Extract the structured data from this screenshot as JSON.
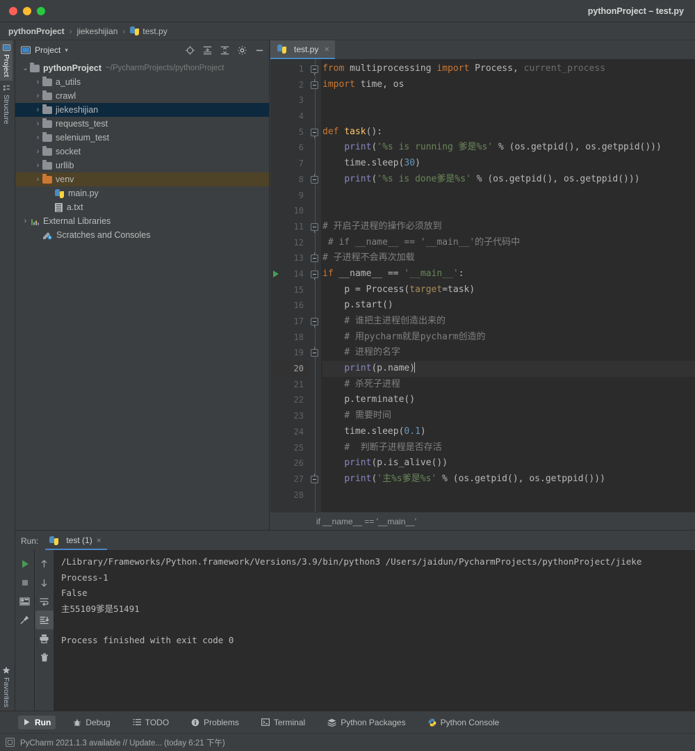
{
  "window": {
    "title": "pythonProject – test.py",
    "traffic_lights": [
      "close",
      "minimize",
      "zoom"
    ]
  },
  "navbar": {
    "crumbs": [
      {
        "label": "pythonProject",
        "icon": ""
      },
      {
        "label": "jiekeshijian",
        "icon": ""
      },
      {
        "label": "test.py",
        "icon": "python-file-icon"
      }
    ],
    "separator": "›"
  },
  "rail": {
    "top": [
      {
        "label": "Project",
        "icon": "project-icon",
        "active": true
      },
      {
        "label": "Structure",
        "icon": "structure-icon",
        "active": false
      }
    ],
    "bottom": [
      {
        "label": "Favorites",
        "icon": "star-icon",
        "active": false
      }
    ]
  },
  "project_panel": {
    "title": "Project",
    "dropdown_caret": "▾",
    "icons": [
      {
        "name": "select-opened-file-icon",
        "glyph": "locate"
      },
      {
        "name": "expand-all-icon",
        "glyph": "expand"
      },
      {
        "name": "collapse-all-icon",
        "glyph": "collapse"
      },
      {
        "name": "settings-gear-icon",
        "glyph": "gear"
      },
      {
        "name": "hide-panel-icon",
        "glyph": "minus"
      }
    ],
    "tree": [
      {
        "label": "pythonProject",
        "path": "~/PycharmProjects/pythonProject",
        "indent": 0,
        "arrow": "⌄",
        "icon": "folder",
        "bold": true,
        "state": "none"
      },
      {
        "label": "a_utils",
        "path": "",
        "indent": 1,
        "arrow": "›",
        "icon": "folder",
        "bold": false,
        "state": "none"
      },
      {
        "label": "crawl",
        "path": "",
        "indent": 1,
        "arrow": "›",
        "icon": "folder",
        "bold": false,
        "state": "none"
      },
      {
        "label": "jiekeshijian",
        "path": "",
        "indent": 1,
        "arrow": "›",
        "icon": "folder",
        "bold": false,
        "state": "selected"
      },
      {
        "label": "requests_test",
        "path": "",
        "indent": 1,
        "arrow": "›",
        "icon": "folder",
        "bold": false,
        "state": "none"
      },
      {
        "label": "selenium_test",
        "path": "",
        "indent": 1,
        "arrow": "›",
        "icon": "folder",
        "bold": false,
        "state": "none"
      },
      {
        "label": "socket",
        "path": "",
        "indent": 1,
        "arrow": "›",
        "icon": "folder",
        "bold": false,
        "state": "none"
      },
      {
        "label": "urllib",
        "path": "",
        "indent": 1,
        "arrow": "›",
        "icon": "folder",
        "bold": false,
        "state": "none"
      },
      {
        "label": "venv",
        "path": "",
        "indent": 1,
        "arrow": "›",
        "icon": "folder-orange",
        "bold": false,
        "state": "highlight"
      },
      {
        "label": "main.py",
        "path": "",
        "indent": 2,
        "arrow": "",
        "icon": "python-file",
        "bold": false,
        "state": "none"
      },
      {
        "label": "a.txt",
        "path": "",
        "indent": 2,
        "arrow": "",
        "icon": "text-file",
        "bold": false,
        "state": "none"
      },
      {
        "label": "External Libraries",
        "path": "",
        "indent": 0,
        "arrow": "›",
        "icon": "library",
        "bold": false,
        "state": "none"
      },
      {
        "label": "Scratches and Consoles",
        "path": "",
        "indent": 1,
        "arrow": "",
        "icon": "scratches",
        "bold": false,
        "state": "none"
      }
    ]
  },
  "editor": {
    "tab": {
      "label": "test.py",
      "icon": "python-file-icon",
      "close": "×"
    },
    "breadcrumb_bottom": "if __name__ == '__main__'",
    "current_line": 20,
    "run_marker_line": 14,
    "lines": [
      {
        "n": 1,
        "fold": "open",
        "text": "from multiprocessing import Process, current_process"
      },
      {
        "n": 2,
        "fold": "end",
        "text": "import time, os"
      },
      {
        "n": 3,
        "fold": "",
        "text": ""
      },
      {
        "n": 4,
        "fold": "",
        "text": ""
      },
      {
        "n": 5,
        "fold": "open",
        "text": "def task():"
      },
      {
        "n": 6,
        "fold": "",
        "text": "    print('%s is running 爹是%s' % (os.getpid(), os.getppid()))"
      },
      {
        "n": 7,
        "fold": "",
        "text": "    time.sleep(30)"
      },
      {
        "n": 8,
        "fold": "end",
        "text": "    print('%s is done爹是%s' % (os.getpid(), os.getppid()))"
      },
      {
        "n": 9,
        "fold": "",
        "text": ""
      },
      {
        "n": 10,
        "fold": "",
        "text": ""
      },
      {
        "n": 11,
        "fold": "open",
        "text": "# 开启子进程的操作必须放到"
      },
      {
        "n": 12,
        "fold": "",
        "text": " # if __name__ == '__main__'的子代码中"
      },
      {
        "n": 13,
        "fold": "end",
        "text": "# 子进程不会再次加载"
      },
      {
        "n": 14,
        "fold": "open",
        "text": "if __name__ == '__main__':"
      },
      {
        "n": 15,
        "fold": "",
        "text": "    p = Process(target=task)"
      },
      {
        "n": 16,
        "fold": "",
        "text": "    p.start()"
      },
      {
        "n": 17,
        "fold": "open",
        "text": "    # 谁把主进程创造出来的"
      },
      {
        "n": 18,
        "fold": "",
        "text": "    # 用pycharm就是pycharm创造的"
      },
      {
        "n": 19,
        "fold": "end",
        "text": "    # 进程的名字"
      },
      {
        "n": 20,
        "fold": "",
        "text": "    print(p.name)"
      },
      {
        "n": 21,
        "fold": "",
        "text": "    # 杀死子进程"
      },
      {
        "n": 22,
        "fold": "",
        "text": "    p.terminate()"
      },
      {
        "n": 23,
        "fold": "",
        "text": "    # 需要时间"
      },
      {
        "n": 24,
        "fold": "",
        "text": "    time.sleep(0.1)"
      },
      {
        "n": 25,
        "fold": "",
        "text": "    #  判断子进程是否存活"
      },
      {
        "n": 26,
        "fold": "",
        "text": "    print(p.is_alive())"
      },
      {
        "n": 27,
        "fold": "end",
        "text": "    print('主%s爹是%s' % (os.getpid(), os.getppid()))"
      },
      {
        "n": 28,
        "fold": "",
        "text": ""
      }
    ]
  },
  "run_panel": {
    "label": "Run:",
    "tab": {
      "label": "test (1)",
      "icon": "python-file-icon",
      "close": "×"
    },
    "tools_left": [
      {
        "name": "rerun-button",
        "glyph": "play"
      },
      {
        "name": "stop-button",
        "glyph": "stop"
      },
      {
        "name": "restore-layout-button",
        "glyph": "layout"
      },
      {
        "name": "pin-tab-button",
        "glyph": "pin"
      }
    ],
    "tools_right": [
      {
        "name": "up-button",
        "glyph": "up"
      },
      {
        "name": "down-button",
        "glyph": "down"
      },
      {
        "name": "soft-wrap-button",
        "glyph": "wrap"
      },
      {
        "name": "scroll-to-end-button",
        "glyph": "scroll-end",
        "active": true
      },
      {
        "name": "print-button",
        "glyph": "print"
      },
      {
        "name": "clear-all-button",
        "glyph": "trash"
      }
    ],
    "output": [
      "/Library/Frameworks/Python.framework/Versions/3.9/bin/python3 /Users/jaidun/PycharmProjects/pythonProject/jieke",
      "Process-1",
      "False",
      "主55109爹是51491",
      "",
      "Process finished with exit code 0"
    ]
  },
  "bottom_toolbar": [
    {
      "label": "Run",
      "icon": "play-icon",
      "active": true
    },
    {
      "label": "Debug",
      "icon": "bug-icon",
      "active": false
    },
    {
      "label": "TODO",
      "icon": "todo-icon",
      "active": false
    },
    {
      "label": "Problems",
      "icon": "info-icon",
      "active": false
    },
    {
      "label": "Terminal",
      "icon": "terminal-icon",
      "active": false
    },
    {
      "label": "Python Packages",
      "icon": "packages-icon",
      "active": false
    },
    {
      "label": "Python Console",
      "icon": "python-console-icon",
      "active": false
    }
  ],
  "statusbar": {
    "icon": "ide-icon",
    "message": "PyCharm 2021.1.3 available // Update... (today 6:21 下午)"
  },
  "colors": {
    "accent": "#4a88c7",
    "selection": "#0d293e",
    "highlight": "#4e4227",
    "editor_bg": "#2b2b2b",
    "panel_bg": "#3c3f41",
    "keyword": "#cc7832",
    "string": "#6a8759",
    "number": "#6897bb",
    "comment": "#808080",
    "function": "#ffc66d",
    "run_green": "#499c54"
  }
}
